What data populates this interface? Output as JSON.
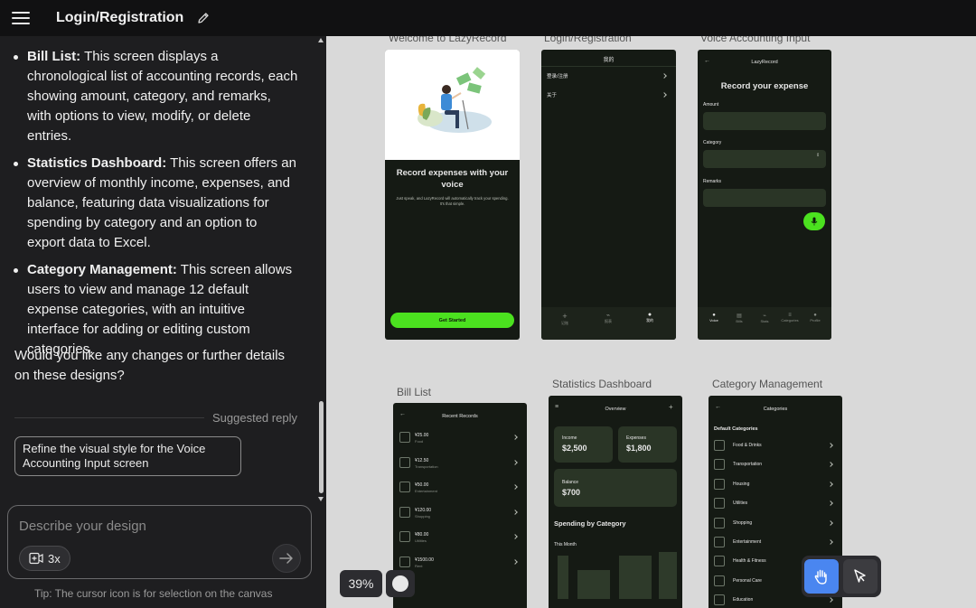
{
  "header": {
    "title": "Login/Registration"
  },
  "chat": {
    "bullets": [
      {
        "title": "Bill List:",
        "text": "This screen displays a chronological list of accounting records, each showing amount, category, and remarks, with options to view, modify, or delete entries."
      },
      {
        "title": "Statistics Dashboard:",
        "text": "This screen offers an overview of monthly income, expenses, and balance, featuring data visualizations for spending by category and an option to export data to Excel."
      },
      {
        "title": "Category Management:",
        "text": "This screen allows users to view and manage 12 default expense categories, with an intuitive interface for adding or editing custom categories."
      }
    ],
    "question": "Would you like any changes or further details on these designs?",
    "suggested_label": "Suggested reply",
    "suggested_reply": "Refine the visual style for the Voice Accounting Input screen",
    "input_placeholder": "Describe your design",
    "multiplier": "3x",
    "tip": "Tip: The cursor icon is for selection on the canvas"
  },
  "canvas": {
    "zoom": "39%",
    "frames": {
      "welcome": {
        "label": "Welcome to LazyRecord",
        "heading": "Record expenses with your voice",
        "body": "Just speak, and LazyRecord will automatically track your spending. It's that simple.",
        "cta": "Get Started"
      },
      "login": {
        "label": "Login/Registration",
        "title": "我的",
        "items": [
          "登录/注册",
          "关于"
        ],
        "tabs": [
          "记账",
          "报表",
          "我的"
        ]
      },
      "voice": {
        "label": "Voice Accounting Input",
        "app_title": "LazyRecord",
        "heading": "Record your expense",
        "fields": [
          "Amount",
          "Category",
          "Remarks"
        ],
        "tabs": [
          "Voice",
          "Bills",
          "Stats",
          "Categories",
          "Profile"
        ]
      },
      "bills": {
        "label": "Bill List",
        "title": "Recent Records",
        "rows": [
          {
            "amount": "¥25.00",
            "category": "Food"
          },
          {
            "amount": "¥12.50",
            "category": "Transportation"
          },
          {
            "amount": "¥50.00",
            "category": "Entertainment"
          },
          {
            "amount": "¥120.00",
            "category": "Shopping"
          },
          {
            "amount": "¥80.00",
            "category": "Utilities"
          },
          {
            "amount": "¥1500.00",
            "category": "Rent"
          }
        ]
      },
      "stats": {
        "label": "Statistics Dashboard",
        "title": "Overview",
        "income_label": "Income",
        "income": "$2,500",
        "expenses_label": "Expenses",
        "expenses": "$1,800",
        "balance_label": "Balance",
        "balance": "$700",
        "section": "Spending by Category",
        "period": "This Month"
      },
      "categories": {
        "label": "Category Management",
        "title": "Categories",
        "section": "Default Categories",
        "items": [
          "Food & Drinks",
          "Transportation",
          "Housing",
          "Utilities",
          "Shopping",
          "Entertainment",
          "Health & Fitness",
          "Personal Care",
          "Education"
        ]
      }
    }
  },
  "colors": {
    "accent": "#4be11f",
    "tool_active": "#4a86f0",
    "panel_bg": "#1e1e20"
  }
}
